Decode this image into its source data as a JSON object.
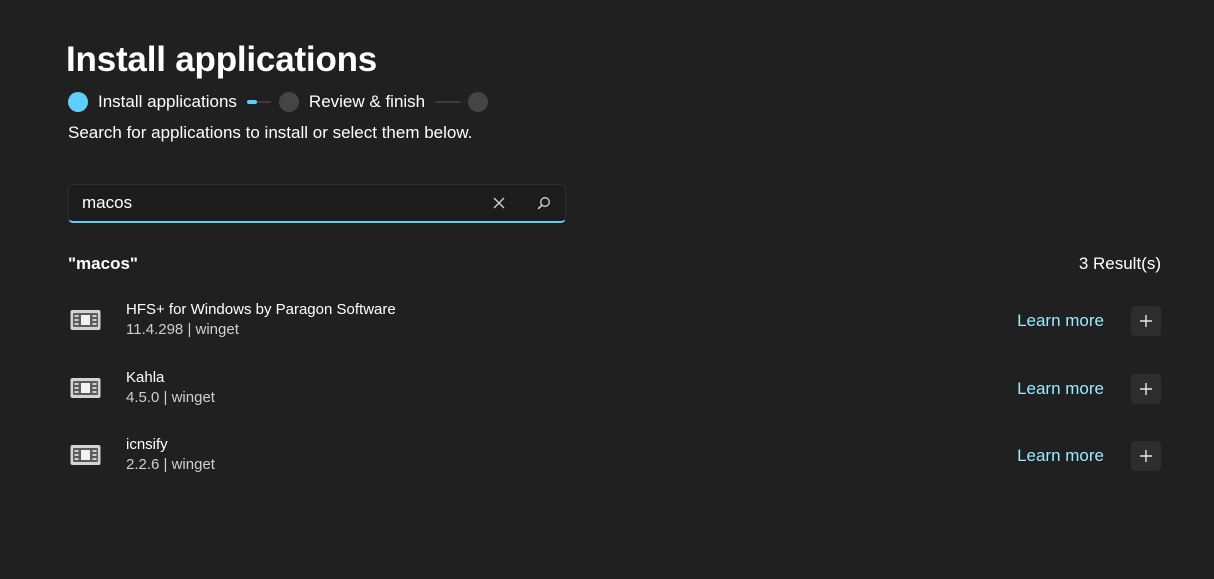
{
  "page": {
    "title": "Install applications",
    "subtitle": "Search for applications to install or select them below."
  },
  "stepper": {
    "steps": [
      {
        "label": "Install applications",
        "state": "active"
      },
      {
        "label": "Review & finish",
        "state": "upcoming"
      },
      {
        "label": "",
        "state": "upcoming"
      }
    ]
  },
  "search": {
    "value": "macos",
    "clear_icon": "close-icon",
    "search_icon": "search-icon"
  },
  "results": {
    "query_label": "\"macos\"",
    "count_label": "3 Result(s)",
    "items": [
      {
        "name": "HFS+ for Windows by Paragon Software",
        "meta": "11.4.298 | winget",
        "learn_more": "Learn more",
        "icon": "app-package-icon"
      },
      {
        "name": "Kahla",
        "meta": "4.5.0 | winget",
        "learn_more": "Learn more",
        "icon": "app-package-icon"
      },
      {
        "name": "icnsify",
        "meta": "2.2.6 | winget",
        "learn_more": "Learn more",
        "icon": "app-package-icon"
      }
    ]
  },
  "colors": {
    "background": "#202020",
    "accent": "#60cdff",
    "link": "#99ebff",
    "button_bg": "#2d2d2d"
  }
}
